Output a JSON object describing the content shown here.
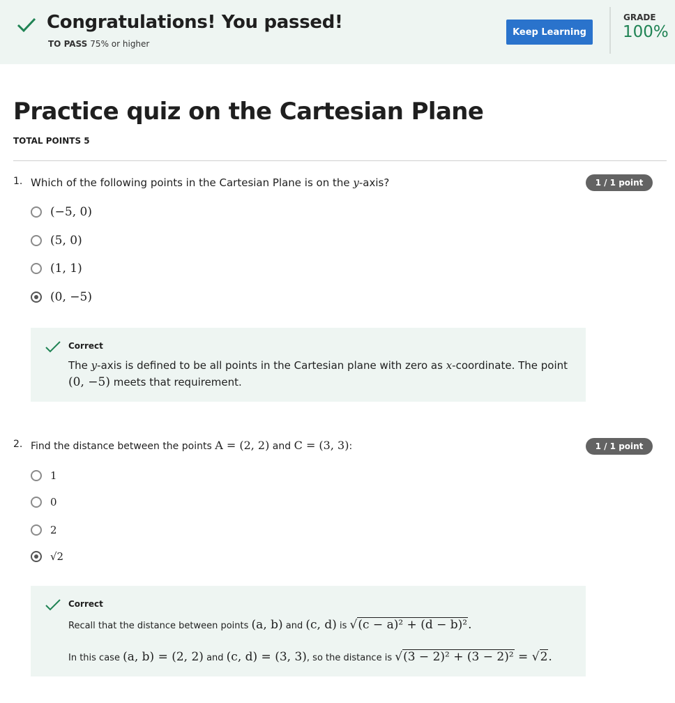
{
  "banner": {
    "title": "Congratulations! You passed!",
    "to_pass_label": "TO PASS",
    "to_pass_value": "75% or higher",
    "keep_learning": "Keep Learning",
    "grade_label": "GRADE",
    "grade_value": "100%"
  },
  "quiz": {
    "title": "Practice quiz on the Cartesian Plane",
    "total_points": "TOTAL POINTS 5"
  },
  "questions": [
    {
      "number": "1.",
      "text_prefix": "Which of the following points in the Cartesian Plane is on the ",
      "text_var": "y",
      "text_suffix": "-axis?",
      "points": "1 / 1 point",
      "options": [
        "(−5, 0)",
        "(5, 0)",
        "(1, 1)",
        "(0, −5)"
      ],
      "selected_index": 3,
      "feedback": {
        "title": "Correct",
        "t1": "The ",
        "t2": "y",
        "t3": "-axis is defined to be all points in the Cartesian plane with zero as ",
        "t4": "x",
        "t5": "-coordinate. The point ",
        "t6": "(0, −5)",
        "t7": " meets that requirement."
      }
    },
    {
      "number": "2.",
      "text_prefix": "Find the distance between the points ",
      "text_a": "A = (2, 2)",
      "text_mid": " and ",
      "text_c": "C = (3, 3)",
      "text_suffix": ":",
      "points": "1 / 1 point",
      "options": [
        "1",
        "0",
        "2",
        "√2"
      ],
      "selected_index": 3,
      "feedback": {
        "title": "Correct",
        "l1_text": "Recall that the distance between points ",
        "l1_ab": "(a, b)",
        "l1_and": " and ",
        "l1_cd": "(c, d)",
        "l1_is": " is ",
        "l1_formula": "(c − a)² + (d − b)²",
        "l1_end": ".",
        "l2_text": "In this case ",
        "l2_ab": "(a, b) = (2, 2)",
        "l2_and": " and ",
        "l2_cd": "(c, d) = (3, 3)",
        "l2_so": ", so the distance is ",
        "l2_formula": "(3 − 2)² + (3 − 2)²",
        "l2_eq": " = ",
        "l2_result": "2",
        "l2_end": "."
      }
    }
  ],
  "colors": {
    "banner_bg": "#eef5f2",
    "accent_blue": "#2a73cc",
    "grade_green": "#1f8354",
    "check_green": "#1f8354",
    "badge_gray": "#636363"
  }
}
